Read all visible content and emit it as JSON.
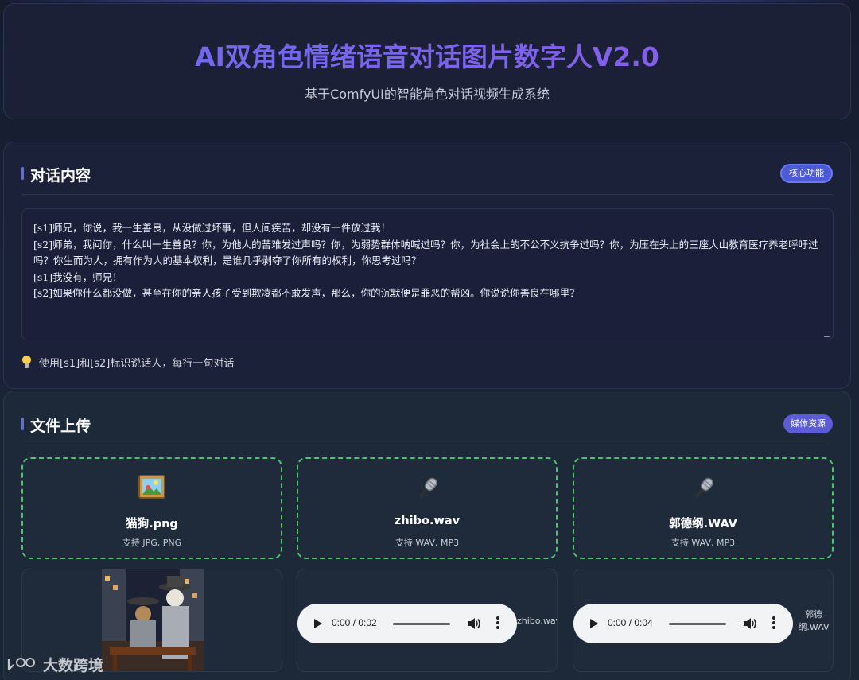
{
  "header": {
    "title": "AI双角色情绪语音对话图片数字人V2.0",
    "subtitle": "基于ComfyUI的智能角色对话视频生成系统"
  },
  "dialog": {
    "section_title": "对话内容",
    "badge": "核心功能",
    "lines": [
      "[s1]师兄，你说，我一生善良，从没做过坏事，但人间疾苦，却没有一件放过我！",
      "[s2]师弟，我问你，什么叫一生善良？你，为他人的苦难发过声吗？你，为弱势群体呐喊过吗？你，为社会上的不公不义抗争过吗？你，为压在头上的三座大山教育医疗养老呼吁过吗？你生而为人，拥有作为人的基本权利，是谁几乎剥夺了你所有的权利，你思考过吗？",
      "[s1]我没有，师兄！",
      "[s2]如果你什么都没做，甚至在你的亲人孩子受到欺凌都不敢发声，那么，你的沉默便是罪恶的帮凶。你说说你善良在哪里？"
    ],
    "hint": "使用[s1]和[s2]标识说话人，每行一句对话"
  },
  "upload": {
    "section_title": "文件上传",
    "badge": "媒体资源",
    "zones": [
      {
        "icon": "picture-icon",
        "name": "猫狗.png",
        "support": "支持 JPG, PNG"
      },
      {
        "icon": "microphone-icon",
        "name": "zhibo.wav",
        "support": "支持 WAV, MP3"
      },
      {
        "icon": "microphone-icon",
        "name": "郭德纲.WAV",
        "support": "支持 WAV, MP3"
      }
    ],
    "audio": [
      {
        "time": "0:00 / 0:02",
        "caption": "zhibo.wav"
      },
      {
        "time": "0:00 / 0:04",
        "caption": "郭德纲.WAV"
      }
    ]
  },
  "watermark": "大数跨境"
}
